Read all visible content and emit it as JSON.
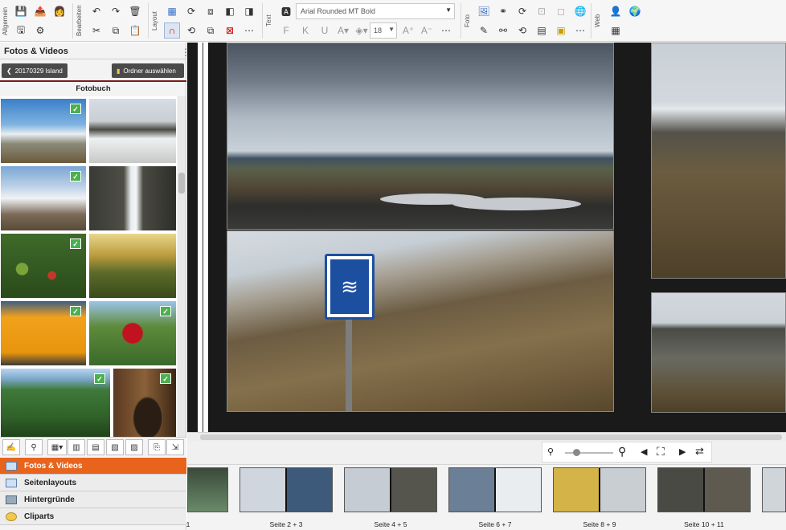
{
  "ribbon": {
    "groups": [
      "Allgemein",
      "Bearbeiten",
      "Layout",
      "Text",
      "Foto",
      "Web"
    ],
    "font_name": "Arial Rounded MT Bold",
    "font_size": "18",
    "text_buttons": [
      "F",
      "K",
      "U"
    ]
  },
  "sidebar": {
    "title": "Fotos & Videos",
    "back_button": "20170329 Island",
    "folder_button": "Ordner auswählen",
    "album_title": "Fotobuch",
    "nav": [
      {
        "label": "Fotos & Videos",
        "active": true
      },
      {
        "label": "Seitenlayouts",
        "active": false
      },
      {
        "label": "Hintergründe",
        "active": false
      },
      {
        "label": "Cliparts",
        "active": false
      }
    ]
  },
  "filmstrip": {
    "labels": [
      "1",
      "Seite 2 + 3",
      "Seite 4 + 5",
      "Seite 6 + 7",
      "Seite 8 + 9",
      "Seite 10 + 11"
    ]
  },
  "colors": {
    "accent": "#e8641c",
    "check": "#4caf50",
    "canvas": "#1a1a1a"
  }
}
